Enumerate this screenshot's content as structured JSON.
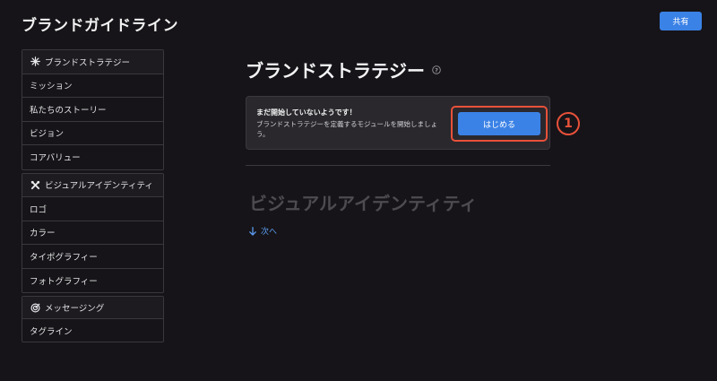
{
  "header": {
    "title": "ブランドガイドライン",
    "share_label": "共有"
  },
  "sidebar": {
    "groups": [
      {
        "title": "ブランドストラテジー",
        "icon": "sparkle-icon",
        "items": [
          "ミッション",
          "私たちのストーリー",
          "ビジョン",
          "コアバリュー"
        ]
      },
      {
        "title": "ビジュアルアイデンティティ",
        "icon": "tools-icon",
        "items": [
          "ロゴ",
          "カラー",
          "タイポグラフィー",
          "フォトグラフィー"
        ]
      },
      {
        "title": "メッセージング",
        "icon": "target-icon",
        "items": [
          "タグライン"
        ]
      }
    ]
  },
  "main": {
    "title": "ブランドストラテジー",
    "notice": {
      "title": "まだ開始していないようです！",
      "text": "ブランドストラテジーを定義するモジュールを開始しましょう。",
      "button_label": "はじめる"
    },
    "step_marker": "1",
    "next_section_title": "ビジュアルアイデンティティ",
    "next_link_label": "次へ"
  },
  "colors": {
    "background": "#161418",
    "accent": "#3b82e6",
    "highlight": "#e8513a"
  }
}
